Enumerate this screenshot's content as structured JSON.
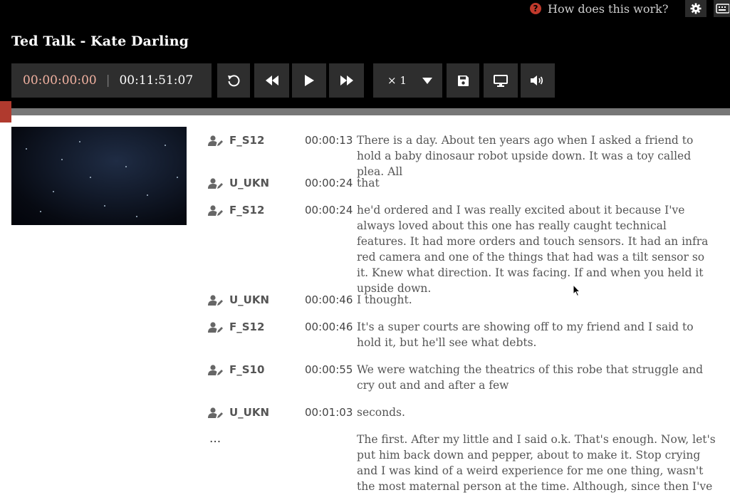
{
  "header": {
    "help_text": "How does this work?",
    "title": "Ted Talk - Kate Darling"
  },
  "player": {
    "current_time": "00:00:00:00",
    "separator": "|",
    "duration": "00:11:51:07",
    "speed_label": "× 1",
    "buttons": [
      "rollback-icon",
      "rewind-icon",
      "play-icon",
      "fast-forward-icon",
      "save-icon",
      "screen-icon",
      "volume-icon"
    ]
  },
  "colors": {
    "topbar": "#000000",
    "button_bg": "#2e2e2e",
    "playhead": "#b03a2e",
    "help_icon": "#c0392b",
    "current_time": "#f2b2a1"
  },
  "transcript": {
    "rows": [
      {
        "speaker": "F_S12",
        "time": "00:00:13",
        "text": "There is a day. About ten years ago when I asked a friend to hold a baby dinosaur robot upside down. It was a toy called plea. All"
      },
      {
        "speaker": "U_UKN",
        "time": "00:00:24",
        "text": "that"
      },
      {
        "speaker": "F_S12",
        "time": "00:00:24",
        "text": "he'd ordered and I was really excited about it because I've always loved about this one has really caught technical features. It had more orders and touch sensors. It had an infra red camera and one of the things that had was a tilt sensor so it. Knew what direction. It was facing. If and when you held it upside down."
      },
      {
        "speaker": "U_UKN",
        "time": "00:00:46",
        "text": "I thought."
      },
      {
        "speaker": "F_S12",
        "time": "00:00:46",
        "text": "It's a super courts are showing off to my friend and I said to hold it, but he'll see what debts."
      },
      {
        "speaker": "F_S10",
        "time": "00:00:55",
        "text": "We were watching the theatrics of this robe that struggle and cry out and and after a few"
      },
      {
        "speaker": "U_UKN",
        "time": "00:01:03",
        "text": "seconds."
      }
    ],
    "ellipsis": "...",
    "tail_text": "The first. After my little and I said o.k. That's enough. Now, let's put him back down and pepper, about to make it. Stop crying and I was kind of a weird experience for me one thing, wasn't the most maternal person at the time. Although, since then I've"
  }
}
